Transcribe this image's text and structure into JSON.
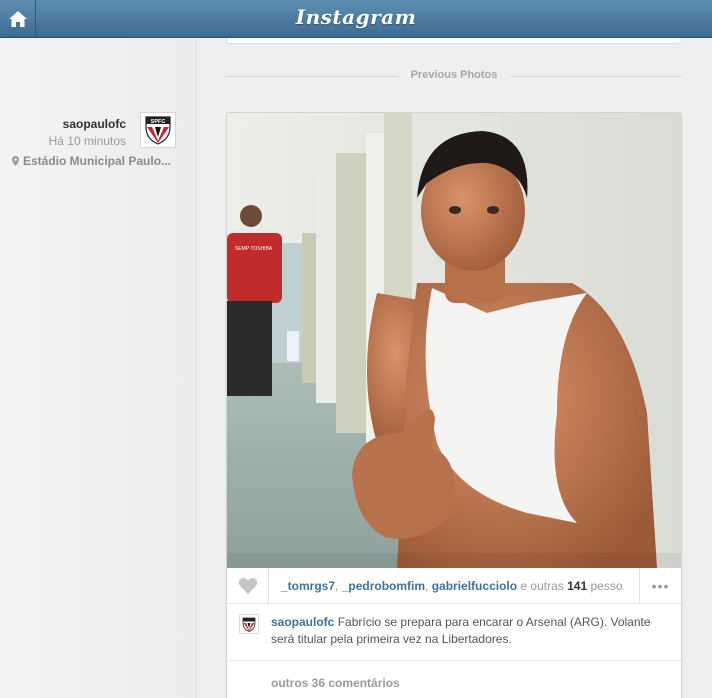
{
  "header": {
    "brand": "Instagram",
    "home_icon": "home-icon"
  },
  "post": {
    "username": "saopaulofc",
    "time": "Há 10 minutos",
    "location": "Estádio Municipal Paulo...",
    "avatar_text": "SPFC"
  },
  "feed": {
    "previous_label": "Previous Photos"
  },
  "likes": {
    "user1": "_tomrgs7",
    "sep1": ", ",
    "user2": "_pedrobomfim",
    "sep2": ", ",
    "user3": "gabrielfucciolo",
    "mid": " e outras ",
    "count": "141",
    "tail": " pesso...",
    "more_label": "•••"
  },
  "caption": {
    "username": "saopaulofc",
    "text": "Fabrício se prepara para encarar o Arsenal (ARG). Volante será titular pela primeira vez na Libertadores."
  },
  "comments": {
    "more_label": "outros 36 comentários"
  },
  "photo": {
    "shirt_text": "SEMP TOSHIBA"
  },
  "colors": {
    "header": "#3d6b92",
    "link": "#3f729b"
  }
}
